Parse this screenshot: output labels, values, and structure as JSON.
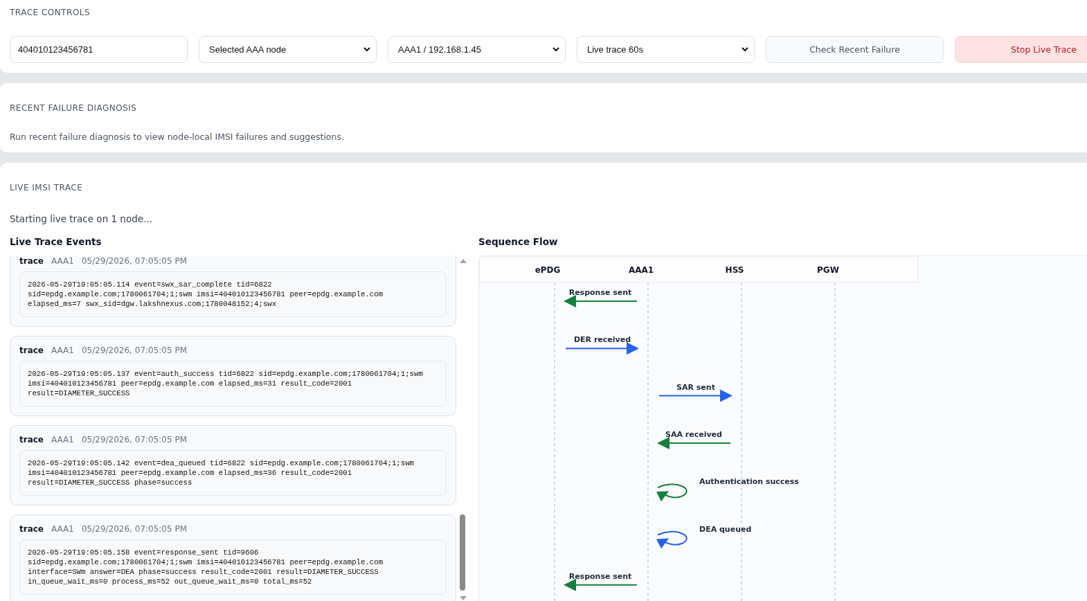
{
  "trace_controls": {
    "title": "TRACE CONTROLS",
    "imsi_field": {
      "value": "404010123456781"
    },
    "dropdowns": [
      {
        "value": "Selected AAA node"
      },
      {
        "value": "AAA1 / 192.168.1.45"
      },
      {
        "value": "Live trace 60s"
      }
    ],
    "buttons": [
      {
        "label": "Check Recent Failure",
        "kind": "secondary"
      },
      {
        "label": "Stop Live Trace",
        "kind": "danger"
      }
    ]
  },
  "recent_failure_diagnosis": {
    "title": "RECENT FAILURE DIAGNOSIS",
    "message": "Run recent failure diagnosis to view node-local IMSI failures and suggestions."
  },
  "live_imsi_trace": {
    "title": "LIVE IMSI TRACE",
    "status": "Starting live trace on 1 node...",
    "events_title": "Live Trace Events",
    "events": [
      {
        "type": "trace",
        "node": "AAA1",
        "time": "05/29/2026, 07:05:05 PM",
        "lines": [
          "2026-05-29T19:05:05.114 event=swx_sar_complete tid=6822",
          "sid=epdg.example.com;1780061704;1;swm imsi=404010123456781 peer=epdg.example.com",
          "elapsed_ms=7 swx_sid=dgw.lakshnexus.com;1780048152;4;swx"
        ]
      },
      {
        "type": "trace",
        "node": "AAA1",
        "time": "05/29/2026, 07:05:05 PM",
        "lines": [
          "2026-05-29T19:05:05.137 event=auth_success tid=6822 sid=epdg.example.com;1780061704;1;swm",
          "imsi=404010123456781 peer=epdg.example.com elapsed_ms=31 result_code=2001",
          "result=DIAMETER_SUCCESS"
        ]
      },
      {
        "type": "trace",
        "node": "AAA1",
        "time": "05/29/2026, 07:05:05 PM",
        "lines": [
          "2026-05-29T19:05:05.142 event=dea_queued tid=6822 sid=epdg.example.com;1780061704;1;swm",
          "imsi=404010123456781 peer=epdg.example.com elapsed_ms=36 result_code=2001",
          "result=DIAMETER_SUCCESS phase=success"
        ]
      },
      {
        "type": "trace",
        "node": "AAA1",
        "time": "05/29/2026, 07:05:05 PM",
        "lines": [
          "2026-05-29T19:05:05.158 event=response_sent tid=9606",
          "sid=epdg.example.com;1780061704;1;swm imsi=404010123456781 peer=epdg.example.com",
          "interface=SWm answer=DEA phase=success result_code=2001 result=DIAMETER_SUCCESS",
          "in_queue_wait_ms=0 process_ms=52 out_queue_wait_ms=0 total_ms=52"
        ]
      }
    ],
    "sequence_title": "Sequence Flow",
    "sequence": {
      "participants": [
        "ePDG",
        "AAA1",
        "HSS",
        "PGW"
      ],
      "messages": [
        {
          "kind": "aaa_to_epdg",
          "label": "Response sent",
          "color": "#15803d"
        },
        {
          "kind": "epdg_to_aaa",
          "label": "DER received",
          "color": "#2563eb"
        },
        {
          "kind": "aaa_to_hss",
          "label": "SAR sent",
          "color": "#2563eb"
        },
        {
          "kind": "hss_to_aaa",
          "label": "SAA received",
          "color": "#15803d"
        },
        {
          "kind": "aaa_self",
          "label": "Authentication success",
          "color": "#15803d"
        },
        {
          "kind": "aaa_self",
          "label": "DEA queued",
          "color": "#2563eb"
        },
        {
          "kind": "aaa_to_epdg",
          "label": "Response sent",
          "color": "#15803d"
        }
      ]
    }
  }
}
